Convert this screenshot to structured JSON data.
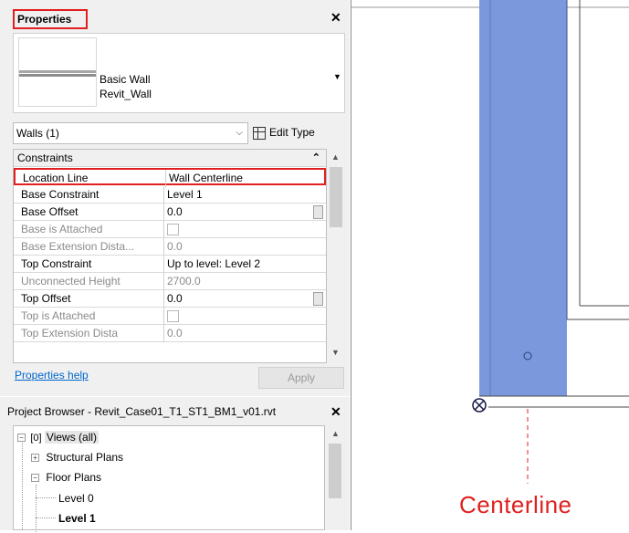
{
  "properties": {
    "title": "Properties",
    "type_family": "Basic Wall",
    "type_name": "Revit_Wall",
    "selector": "Walls (1)",
    "edit_type_label": "Edit Type",
    "section": "Constraints",
    "rows": [
      {
        "label": "Location Line",
        "value": "Wall Centerline",
        "state": "highlighted"
      },
      {
        "label": "Base Constraint",
        "value": "Level 1",
        "state": "normal"
      },
      {
        "label": "Base Offset",
        "value": "0.0",
        "state": "normal"
      },
      {
        "label": "Base is Attached",
        "value": "",
        "state": "disabled-checkbox"
      },
      {
        "label": "Base Extension Dista...",
        "value": "0.0",
        "state": "disabled"
      },
      {
        "label": "Top Constraint",
        "value": "Up to level: Level 2",
        "state": "normal"
      },
      {
        "label": "Unconnected Height",
        "value": "2700.0",
        "state": "disabled"
      },
      {
        "label": "Top Offset",
        "value": "0.0",
        "state": "normal"
      },
      {
        "label": "Top is Attached",
        "value": "",
        "state": "disabled-checkbox"
      },
      {
        "label": "Top Extension Dista",
        "value": "0.0",
        "state": "disabled"
      }
    ],
    "help_link": "Properties help",
    "apply_button": "Apply"
  },
  "project_browser": {
    "title": "Project Browser - Revit_Case01_T1_ST1_BM1_v01.rvt",
    "tree": [
      {
        "label": "Views (all)",
        "level": 0,
        "expanded": true,
        "selected": true
      },
      {
        "label": "Structural Plans",
        "level": 1,
        "expanded": false
      },
      {
        "label": "Floor Plans",
        "level": 1,
        "expanded": true
      },
      {
        "label": "Level 0",
        "level": 2
      },
      {
        "label": "Level 1",
        "level": 2,
        "bold": true
      }
    ]
  },
  "canvas": {
    "annotation_label": "Centerline",
    "wall_color": "#7b98dc",
    "annotation_color": "#e02020"
  }
}
